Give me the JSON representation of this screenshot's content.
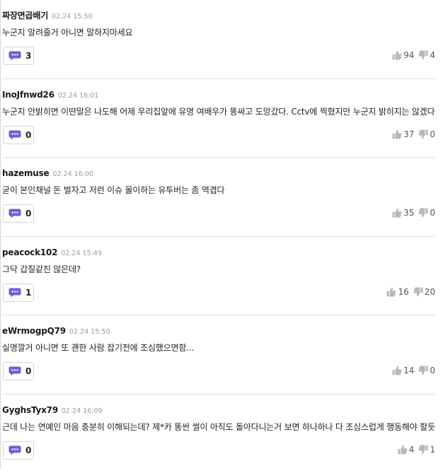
{
  "comments": [
    {
      "author": "짜장면곱배기",
      "date": "02.24 15:50",
      "text": "누군지 알려줄거 아니면 말하지마세요",
      "replies": "3",
      "likes": "94",
      "dislikes": "4"
    },
    {
      "author": "InoJfnwd26",
      "date": "02.24 16:01",
      "text": "누군지 안밝히면 이딴말은 나도해 어제 우리집앞에 유명 여배우가 똥싸고 도망갔다. Cctv에 찍혔지만 누군지 밝히지는 않겠다",
      "replies": "0",
      "likes": "37",
      "dislikes": "0"
    },
    {
      "author": "hazemuse",
      "date": "02.24 16:00",
      "text": "굳이 본인채널 돈 벌자고 저런 이슈 몰이하는 유투버는 좀 역겹다",
      "replies": "0",
      "likes": "35",
      "dislikes": "0"
    },
    {
      "author": "peacock102",
      "date": "02.24 15:49",
      "text": "그닥 갑질같진 않은데?",
      "replies": "1",
      "likes": "16",
      "dislikes": "20"
    },
    {
      "author": "eWrmogpQ79",
      "date": "02.24 15:50",
      "text": "실명깔거 아니면 또 괜한 사람 잡기전에 조심했으면함...",
      "replies": "0",
      "likes": "14",
      "dislikes": "0"
    },
    {
      "author": "GyghsTyx79",
      "date": "02.24 16:09",
      "text": "근데 나는 연예인 마음 충분히 이해되는데? 제*카 똥싼 썰이 아직도 돌아다니는거 보면 하나하나 다 조심스럽게 행동해야 할듯",
      "replies": "0",
      "likes": "4",
      "dislikes": "1"
    }
  ],
  "icons": {
    "reply": "speech-bubble-icon",
    "like": "thumbs-up-icon",
    "dislike": "thumbs-down-icon"
  },
  "colors": {
    "reply_icon": "#6a5fd8",
    "vote_icon": "#b8b8b8",
    "divider": "#dedede"
  }
}
